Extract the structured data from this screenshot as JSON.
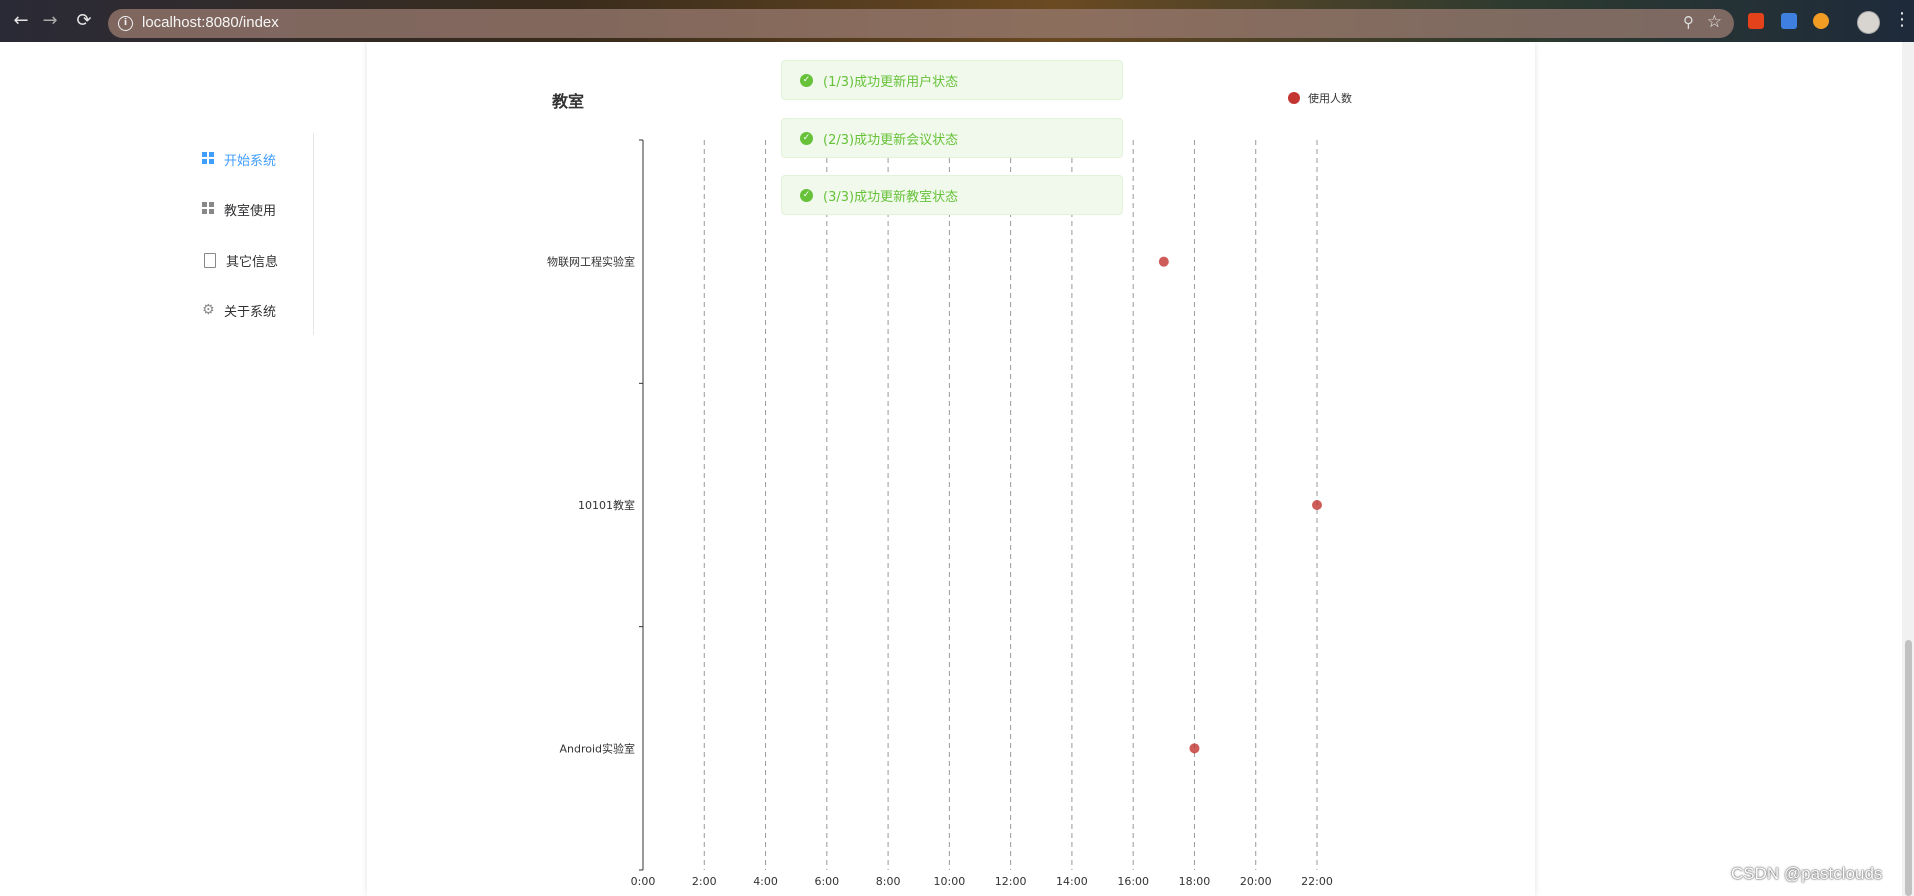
{
  "browser": {
    "url": "localhost:8080/index",
    "back_glyph": "←",
    "forward_glyph": "→",
    "reload_glyph": "⟳",
    "zoom_glyph": "⚲",
    "star_glyph": "☆",
    "info_glyph": "i",
    "menu_glyph": "⋮"
  },
  "sidebar": {
    "items": [
      {
        "label": "开始系统",
        "icon": "grid-icon",
        "active": true
      },
      {
        "label": "教室使用",
        "icon": "grid-icon",
        "active": false
      },
      {
        "label": "其它信息",
        "icon": "document-icon",
        "active": false
      },
      {
        "label": "关于系统",
        "icon": "gear-icon",
        "active": false
      }
    ]
  },
  "toasts": [
    {
      "text": "(1/3)成功更新用户状态"
    },
    {
      "text": "(2/3)成功更新会议状态"
    },
    {
      "text": "(3/3)成功更新教室状态"
    }
  ],
  "chart_data": {
    "type": "scatter",
    "title": "教室",
    "legend": {
      "entries": [
        "使用人数"
      ],
      "position": "top-right"
    },
    "colors": {
      "series": "#c23531"
    },
    "x_ticks": [
      "0:00",
      "2:00",
      "4:00",
      "6:00",
      "8:00",
      "10:00",
      "12:00",
      "14:00",
      "16:00",
      "18:00",
      "20:00",
      "22:00"
    ],
    "xlim": [
      0,
      22
    ],
    "y_categories": [
      "物联网工程实验室",
      "10101教室",
      "Android实验室"
    ],
    "grid": "vertical-dashed",
    "series": [
      {
        "name": "使用人数",
        "points": [
          {
            "category": "物联网工程实验室",
            "x": 17
          },
          {
            "category": "10101教室",
            "x": 22
          },
          {
            "category": "Android实验室",
            "x": 18
          }
        ]
      }
    ]
  },
  "watermark": "CSDN @pastclouds"
}
